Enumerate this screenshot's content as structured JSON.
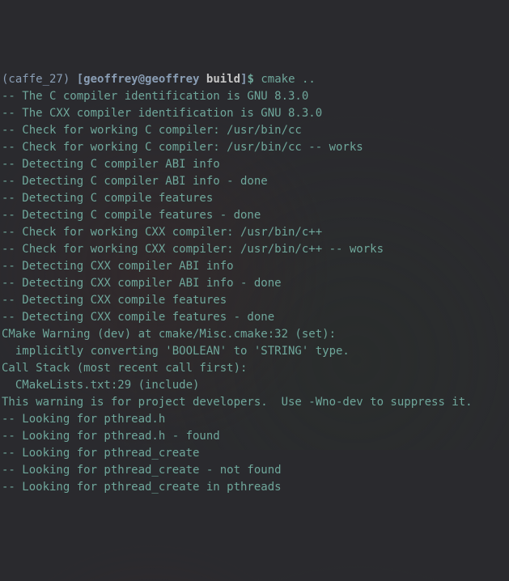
{
  "prompt": {
    "env": "(caffe_27)",
    "open_bracket": "[",
    "user_host": "geoffrey@geoffrey",
    "dir": "build",
    "close_bracket": "]",
    "dollar": "$",
    "command": "cmake .."
  },
  "lines": [
    "-- The C compiler identification is GNU 8.3.0",
    "-- The CXX compiler identification is GNU 8.3.0",
    "-- Check for working C compiler: /usr/bin/cc",
    "-- Check for working C compiler: /usr/bin/cc -- works",
    "-- Detecting C compiler ABI info",
    "-- Detecting C compiler ABI info - done",
    "-- Detecting C compile features",
    "-- Detecting C compile features - done",
    "-- Check for working CXX compiler: /usr/bin/c++",
    "-- Check for working CXX compiler: /usr/bin/c++ -- works",
    "-- Detecting CXX compiler ABI info",
    "-- Detecting CXX compiler ABI info - done",
    "-- Detecting CXX compile features",
    "-- Detecting CXX compile features - done",
    "CMake Warning (dev) at cmake/Misc.cmake:32 (set):",
    "  implicitly converting 'BOOLEAN' to 'STRING' type.",
    "Call Stack (most recent call first):",
    "  CMakeLists.txt:29 (include)",
    "This warning is for project developers.  Use -Wno-dev to suppress it.",
    "",
    "-- Looking for pthread.h",
    "-- Looking for pthread.h - found",
    "-- Looking for pthread_create",
    "-- Looking for pthread_create - not found",
    "-- Looking for pthread_create in pthreads"
  ]
}
